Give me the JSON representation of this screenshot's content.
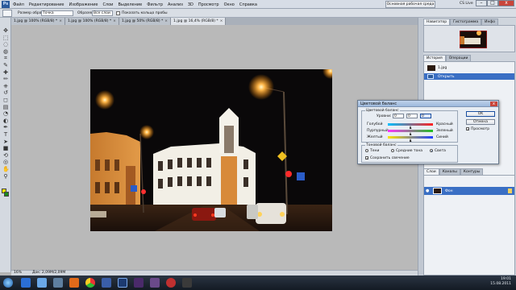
{
  "menubar": {
    "logo": "Ps",
    "items": [
      "Файл",
      "Редактирование",
      "Изображение",
      "Слои",
      "Выделение",
      "Фильтр",
      "Анализ",
      "3D",
      "Просмотр",
      "Окно",
      "Справка"
    ],
    "workspace_button": "Основная рабочая среда",
    "cs_live": "CS Live",
    "min": "–",
    "max": "□",
    "close": "x"
  },
  "options": {
    "sample_size_label": "Размер образца:",
    "sample_size_value": "Точка",
    "sample_label": "Образец:",
    "sample_value": "Все слои",
    "show_ring_label": "Показать кольцо пробы"
  },
  "tabs": [
    {
      "label": "1.jpg @ 100% (RGB/8) *",
      "active": false
    },
    {
      "label": "1.jpg @ 100% (RGB/8) *",
      "active": false
    },
    {
      "label": "1.jpg @ 50% (RGB/8) *",
      "active": false
    },
    {
      "label": "1.jpg @ 16,4% (RGB/8) *",
      "active": true
    }
  ],
  "status": {
    "zoom": "16%",
    "doc": "Док: 2,09M/2,09M"
  },
  "navigator": {
    "tabs": [
      "Навигатор",
      "Гистограмма",
      "Инфо"
    ],
    "active_index": 0
  },
  "history": {
    "tabs": [
      "История",
      "Операции"
    ],
    "active_index": 0,
    "file": "1.jpg",
    "items": [
      {
        "label": "Открыть",
        "selected": true
      }
    ]
  },
  "layers": {
    "tabs": [
      "Слои",
      "Каналы",
      "Контуры"
    ],
    "active_index": 0,
    "layer_name": "Фон"
  },
  "dialog": {
    "title": "Цветовой баланс",
    "color_balance_legend": "Цветовой баланс",
    "levels_label": "Уровни:",
    "levels": [
      "0",
      "0",
      "0"
    ],
    "left_labels": [
      "Голубой",
      "Пурпурный",
      "Желтый"
    ],
    "right_labels": [
      "Красный",
      "Зеленый",
      "Синий"
    ],
    "thumb_positions": [
      0.5,
      0.5,
      0.5
    ],
    "tone_legend": "Тоновой баланс",
    "tones": [
      "Тени",
      "Средние тона",
      "Света"
    ],
    "tone_selected": 2,
    "preserve_label": "Сохранить свечение",
    "preserve_checked": true,
    "ok": "OK",
    "cancel": "Отмена",
    "preview_label": "Просмотр",
    "preview_checked": true,
    "close": "x"
  },
  "taskbar": {
    "time": "19:01",
    "date": "15.08.2011"
  },
  "colors": {
    "foreground": "#f1e400",
    "background": "#1c8a1c",
    "accent": "#1a4fa0"
  }
}
